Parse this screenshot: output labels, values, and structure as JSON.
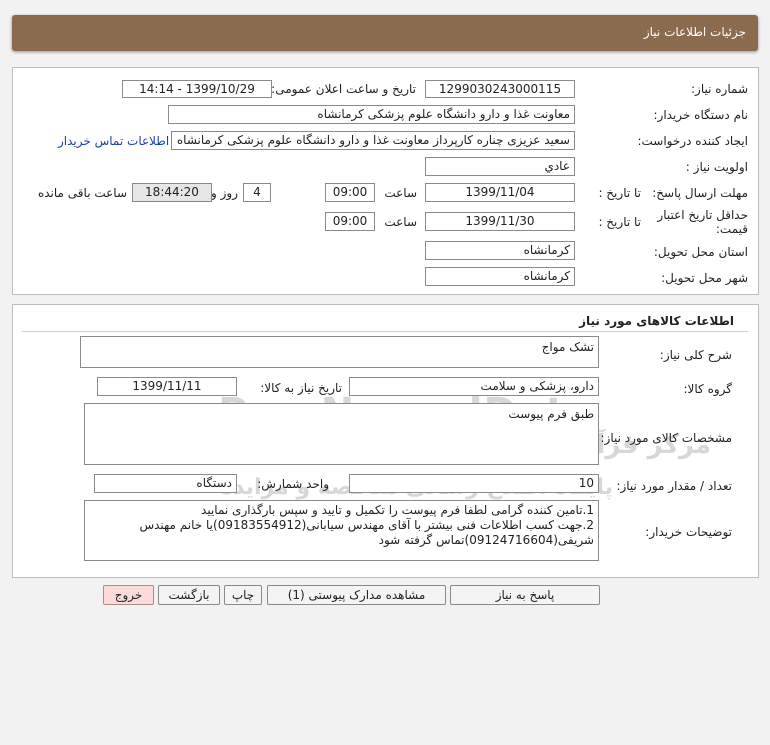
{
  "header": {
    "title": "جزئیات اطلاعات نیاز"
  },
  "info": {
    "need_number_label": "شماره نیاز:",
    "need_number": "1299030243000115",
    "announce_label": "تاریخ و ساعت اعلان عمومی:",
    "announce_value": "1399/10/29 - 14:14",
    "buyer_org_label": "نام دستگاه خریدار:",
    "buyer_org": "معاونت غذا و دارو دانشگاه علوم پزشکی کرمانشاه",
    "creator_label": "ایجاد کننده درخواست:",
    "creator": "سعید عزیزی چناره کارپرداز معاونت غذا و دارو دانشگاه علوم پزشکی کرمانشاه",
    "contact_link": "اطلاعات تماس خریدار",
    "priority_label": "اولویت نیاز :",
    "priority": "عادي",
    "deadline_label": "مهلت ارسال پاسخ:",
    "until_date_label": "تا تاریخ :",
    "deadline_date": "1399/11/04",
    "time_label": "ساعت",
    "deadline_time": "09:00",
    "days_value": "4",
    "days_label": "روز و",
    "remaining_time": "18:44:20",
    "remaining_label": "ساعت باقی مانده",
    "validity_label": "حداقل تاریخ اعتبار قیمت:",
    "validity_date": "1399/11/30",
    "validity_time": "09:00",
    "province_label": "استان محل تحویل:",
    "province": "کرمانشاه",
    "city_label": "شهر محل تحویل:",
    "city": "کرمانشاه"
  },
  "goods": {
    "section_title": "اطلاعات کالاهای مورد نیاز",
    "summary_label": "شرح کلی نیاز:",
    "summary": "تشک مواج",
    "group_label": "گروه کالا:",
    "group": "دارو، پزشکی و سلامت",
    "need_date_label": "تاریخ نیاز به کالا:",
    "need_date": "1399/11/11",
    "spec_label": "مشخصات کالای مورد نیاز:",
    "spec": "طبق فرم پیوست",
    "qty_label": "تعداد / مقدار مورد نیاز:",
    "qty": "10",
    "unit_label": "واحد شمارش:",
    "unit": "دستگاه",
    "notes_label": "توضیحات خریدار:",
    "notes": "1.تامین کننده گرامی لطفا فرم پیوست را تکمیل و تایید و سپس بارگذاری نمایید\n2.جهت کسب اطلاعات فنی بیشتر با آقای مهندس سیابانی(09183554912)یا خانم مهندس شریفی(09124716604)تماس گرفته شود"
  },
  "buttons": {
    "reply": "پاسخ به نیاز",
    "attachments": "مشاهده مدارک پیوستی (1)",
    "print": "چاپ",
    "back": "بازگشت",
    "exit": "خروج"
  },
  "watermark": {
    "brand": "ParsNamadData",
    "line1": "مرکز فرآوری اطلاعات پارس نماد داده ها",
    "line2": "پایگاه اطلاع رسانی مناقصه و مزایده"
  }
}
